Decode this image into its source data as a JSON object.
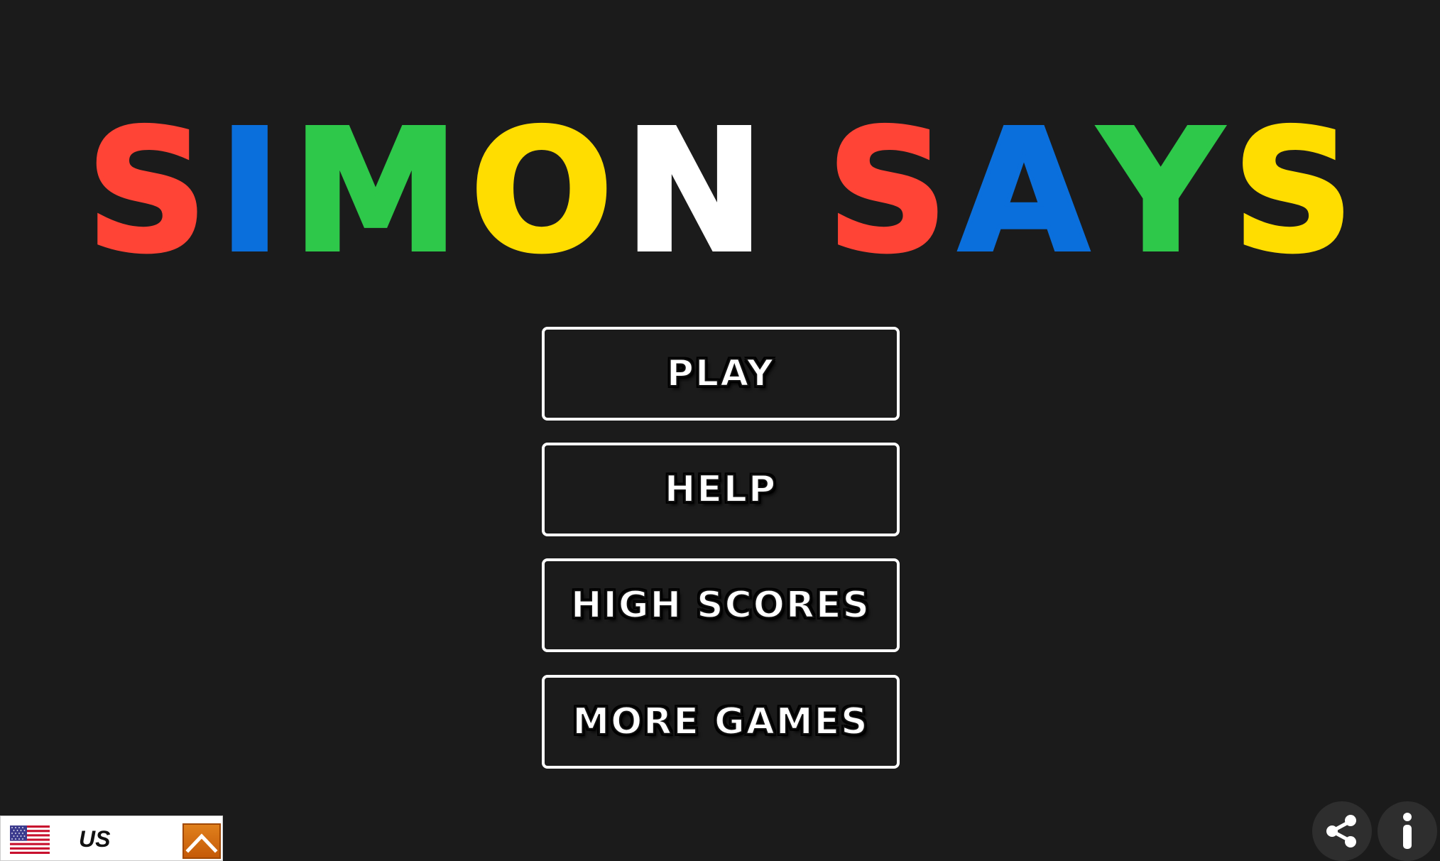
{
  "title": {
    "words": [
      {
        "letters": [
          {
            "char": "S",
            "color": "#ff4436"
          },
          {
            "char": "I",
            "color": "#0a6fdc"
          },
          {
            "char": "M",
            "color": "#2ec84a"
          },
          {
            "char": "O",
            "color": "#ffdd00"
          },
          {
            "char": "N",
            "color": "#ffffff"
          }
        ]
      },
      {
        "letters": [
          {
            "char": "S",
            "color": "#ff4436"
          },
          {
            "char": "A",
            "color": "#0a6fdc"
          },
          {
            "char": "Y",
            "color": "#2ec84a"
          },
          {
            "char": "S",
            "color": "#ffdd00"
          }
        ]
      }
    ]
  },
  "menu": {
    "play_label": "PLAY",
    "help_label": "HELP",
    "high_scores_label": "HIGH SCORES",
    "more_games_label": "MORE GAMES"
  },
  "language": {
    "code": "US",
    "flag_icon": "us-flag-icon",
    "toggle_icon": "chevron-up-icon"
  },
  "actions": {
    "share_icon": "share-icon",
    "info_icon": "info-icon"
  },
  "colors": {
    "background": "#1b1b1b",
    "button_border": "#ffffff",
    "red": "#ff4436",
    "blue": "#0a6fdc",
    "green": "#2ec84a",
    "yellow": "#ffdd00",
    "white": "#ffffff",
    "toggle_orange": "#e0801c"
  }
}
